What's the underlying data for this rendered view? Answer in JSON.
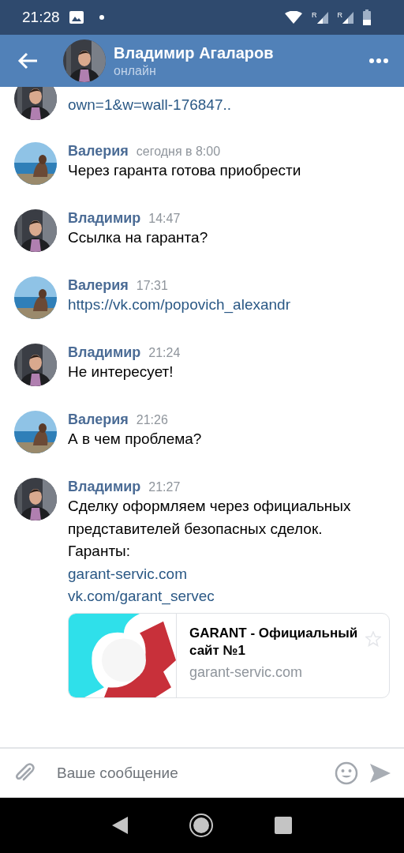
{
  "status_bar": {
    "time": "21:28",
    "signal_labels": [
      "R",
      "R"
    ]
  },
  "header": {
    "title": "Владимир Агаларов",
    "subtitle": "онлайн"
  },
  "messages": [
    {
      "lines": [
        {
          "text": "own=1&w=wall-176847..",
          "kind": "link"
        }
      ]
    },
    {
      "author": "Валерия",
      "time": "сегодня в 8:00",
      "lines": [
        {
          "text": "Через гаранта готова приобрести",
          "kind": "text"
        }
      ]
    },
    {
      "author": "Владимир",
      "time": "14:47",
      "lines": [
        {
          "text": "Ссылка на гаранта?",
          "kind": "text"
        }
      ]
    },
    {
      "author": "Валерия",
      "time": "17:31",
      "lines": [
        {
          "text": "https://vk.com/popovich_alexandr",
          "kind": "link"
        }
      ]
    },
    {
      "author": "Владимир",
      "time": "21:24",
      "lines": [
        {
          "text": "Не интересует!",
          "kind": "text"
        }
      ]
    },
    {
      "author": "Валерия",
      "time": "21:26",
      "lines": [
        {
          "text": "А в чем проблема?",
          "kind": "text"
        }
      ]
    },
    {
      "author": "Владимир",
      "time": "21:27",
      "lines": [
        {
          "text": "Сделку оформляем через официальных представителей безопасных сделок.",
          "kind": "text"
        },
        {
          "text": "Гаранты:",
          "kind": "text"
        },
        {
          "text": "garant-servic.com",
          "kind": "link"
        },
        {
          "text": "vk.com/garant_servec",
          "kind": "link"
        }
      ],
      "preview": {
        "title": "GARANT - Официальный сайт №1",
        "domain": "garant-servic.com"
      }
    }
  ],
  "composer": {
    "placeholder": "Ваше сообщение"
  }
}
